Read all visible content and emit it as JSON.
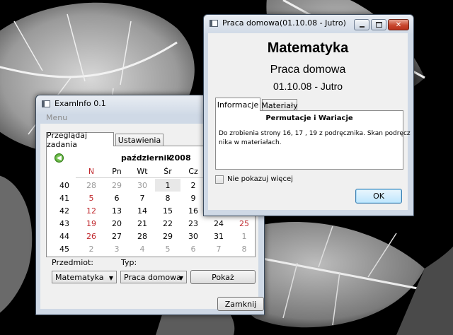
{
  "colors": {
    "accent": "#3b6fb0",
    "weekend": "#c0282d",
    "muted": "#9a9a9a"
  },
  "examinfo": {
    "title": "ExamInfo 0.1",
    "menu_label": "Menu",
    "tabs": [
      "Przeglądaj zadania",
      "Ustawienia"
    ],
    "calendar": {
      "month": "październik",
      "year": "2008",
      "day_headers": [
        "N",
        "Pn",
        "Wt",
        "Śr",
        "Cz"
      ],
      "week_numbers": [
        "40",
        "41",
        "42",
        "43",
        "44",
        "45"
      ],
      "rows": [
        [
          "28",
          "29",
          "30",
          "1",
          "2"
        ],
        [
          "5",
          "6",
          "7",
          "8",
          "9"
        ],
        [
          "12",
          "13",
          "14",
          "15",
          "16"
        ],
        [
          "19",
          "20",
          "21",
          "22",
          "23"
        ],
        [
          "26",
          "27",
          "28",
          "29",
          "30"
        ],
        [
          "2",
          "3",
          "4",
          "5",
          "6"
        ]
      ],
      "extra_cols": [
        [
          "24",
          "25"
        ],
        [
          "31",
          "1"
        ],
        [
          "7",
          "8"
        ]
      ]
    },
    "subject_label": "Przedmiot:",
    "subject_value": "Matematyka",
    "type_label": "Typ:",
    "type_value": "Praca domowa",
    "show_button": "Pokaż",
    "close_button": "Zamknij"
  },
  "popup": {
    "title": "Praca domowa(01.10.08 - Jutro)",
    "subject": "Matematyka",
    "kind": "Praca domowa",
    "date": "01.10.08 - Jutro",
    "tabs": [
      "Informacje",
      "Materiały"
    ],
    "topic": "Permutacje i Wariacje",
    "body_line1": "Do zrobienia strony 16, 17 , 19 z podręcznika. Skan podręcz",
    "body_line2": "nika w materiałach.",
    "checkbox_label": "Nie pokazuj więcej",
    "ok_button": "OK"
  }
}
